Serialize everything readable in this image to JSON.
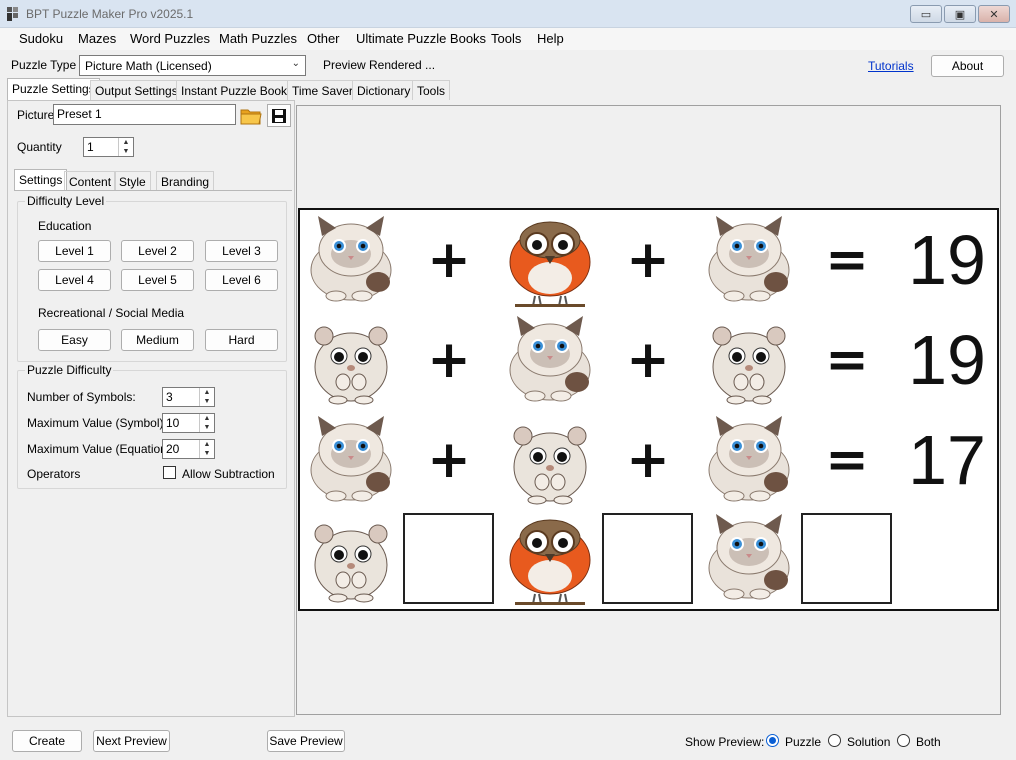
{
  "window": {
    "title": "BPT Puzzle Maker Pro v2025.1"
  },
  "menu": [
    "Sudoku",
    "Mazes",
    "Word Puzzles",
    "Math Puzzles",
    "Other",
    "Ultimate Puzzle Books",
    "Tools",
    "Help"
  ],
  "toolbar": {
    "puzzle_type_label": "Puzzle Type",
    "puzzle_type_value": "Picture Math (Licensed)",
    "preview_status": "Preview Rendered ...",
    "tutorials_link": "Tutorials",
    "about_label": "About"
  },
  "tabs": [
    "Puzzle Settings",
    "Output Settings",
    "Instant Puzzle Books",
    "Time Saver",
    "Dictionary",
    "Tools"
  ],
  "settings": {
    "picture_label": "Picture",
    "picture_value": "Preset 1",
    "quantity_label": "Quantity",
    "quantity_value": "1",
    "subtabs": [
      "Settings",
      "Content",
      "Style",
      "Branding"
    ],
    "difficulty_group": "Difficulty Level",
    "education_label": "Education",
    "education_levels": [
      "Level 1",
      "Level 2",
      "Level 3",
      "Level 4",
      "Level 5",
      "Level 6"
    ],
    "recreational_label": "Recreational / Social Media",
    "recreational_levels": [
      "Easy",
      "Medium",
      "Hard"
    ],
    "puzzle_difficulty_group": "Puzzle Difficulty",
    "num_symbols_label": "Number of Symbols:",
    "num_symbols_value": "3",
    "max_symbol_label": "Maximum Value (Symbol):",
    "max_symbol_value": "10",
    "max_equation_label": "Maximum Value (Equation):",
    "max_equation_value": "20",
    "operators_label": "Operators",
    "allow_subtraction_label": "Allow Subtraction",
    "allow_subtraction_checked": false
  },
  "puzzle": {
    "rows": [
      {
        "items": [
          "cat",
          "+",
          "bird",
          "+",
          "cat",
          "=",
          "19"
        ]
      },
      {
        "items": [
          "hamster",
          "+",
          "cat",
          "+",
          "hamster",
          "=",
          "19"
        ]
      },
      {
        "items": [
          "cat",
          "+",
          "hamster",
          "+",
          "cat",
          "=",
          "17"
        ]
      },
      {
        "items": [
          "hamster",
          "blank",
          "bird",
          "blank",
          "cat",
          "blank",
          ""
        ]
      }
    ]
  },
  "footer": {
    "create_label": "Create",
    "next_preview_label": "Next Preview",
    "save_preview_label": "Save Preview",
    "show_preview_label": "Show Preview:",
    "options": [
      "Puzzle",
      "Solution",
      "Both"
    ],
    "selected": "Puzzle"
  },
  "colors": {
    "accent": "#0a5fd4",
    "titlebar": "#d9e4f1",
    "link": "#0033cc"
  }
}
